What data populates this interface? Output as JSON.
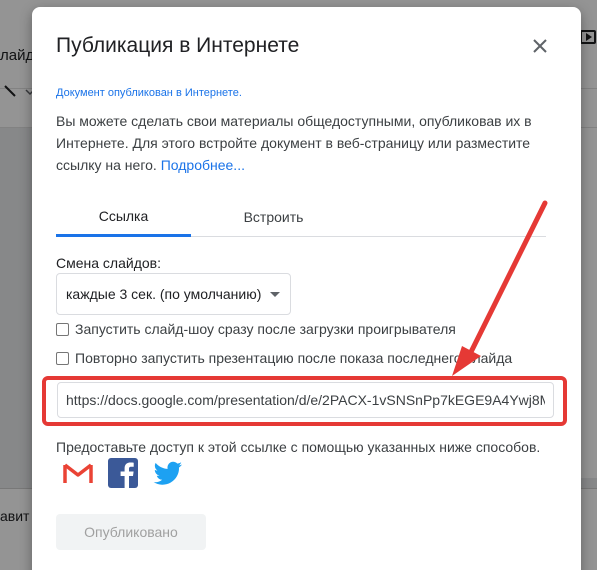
{
  "background": {
    "menu_fragment": "лайд",
    "bottom_fragment": "авит"
  },
  "dialog": {
    "title": "Публикация в Интернете",
    "published_note": "Документ опубликован в Интернете.",
    "description": "Вы можете сделать свои материалы общедоступными, опубликовав их в Интернете. Для этого встройте документ в веб-страницу или разместите ссылку на него.",
    "learn_more": "Подробнее...",
    "tabs": [
      {
        "label": "Ссылка",
        "active": true
      },
      {
        "label": "Встроить",
        "active": false
      }
    ],
    "slide_change_label": "Смена слайдов:",
    "slide_change_value": "каждые 3 сек. (по умолчанию)",
    "options": [
      {
        "label": "Запустить слайд-шоу сразу после загрузки проигрывателя",
        "checked": false
      },
      {
        "label": "Повторно запустить презентацию после показа последнего слайда",
        "checked": false
      }
    ],
    "url": "https://docs.google.com/presentation/d/e/2PACX-1vSNSnPp7kEGE9A4Ywj8M",
    "share_text": "Предоставьте доступ к этой ссылке с помощью указанных ниже способов.",
    "share_services": [
      "gmail-icon",
      "facebook-icon",
      "twitter-icon"
    ],
    "publish_label": "Опубликовано"
  },
  "colors": {
    "accent": "#1a73e8",
    "annotation": "#e53935",
    "gmail_red": "#ea4335",
    "facebook": "#3b5998",
    "twitter": "#1da1f2"
  }
}
